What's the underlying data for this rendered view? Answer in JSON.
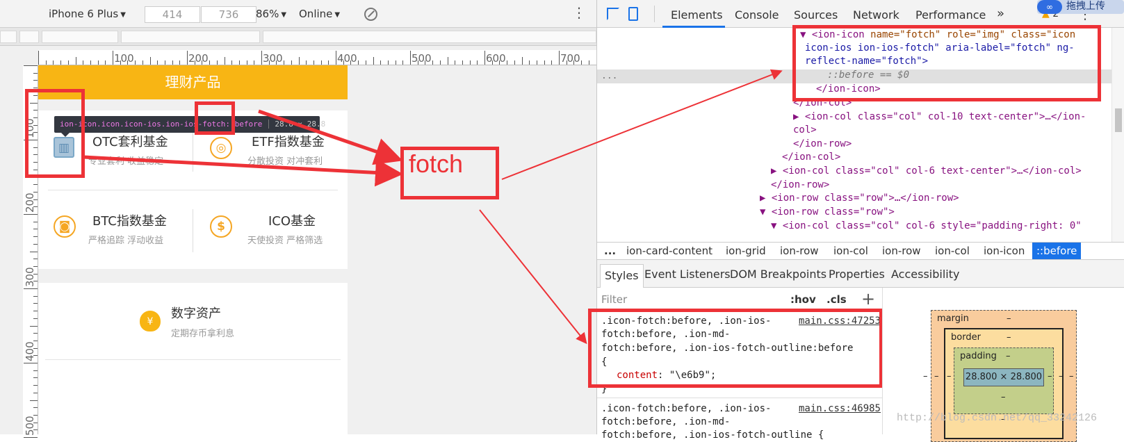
{
  "device_toolbar": {
    "device": "iPhone 6 Plus",
    "width": "414",
    "times": "×",
    "height": "736",
    "zoom": "86%",
    "network": "Online",
    "arrow": "▼",
    "rotate_icon": "rotate-icon",
    "more": "⋮"
  },
  "ruler": {
    "h_labels": [
      "100",
      "200",
      "300",
      "400",
      "500",
      "600",
      "700"
    ],
    "v_labels": [
      "100",
      "200",
      "300",
      "400",
      "500"
    ]
  },
  "phone": {
    "header_title": "理财产品",
    "products": [
      {
        "title": "OTC套利基金",
        "subtitle": "专业套利 收益稳定"
      },
      {
        "title": "ETF指数基金",
        "subtitle": "分散投资 对冲套利"
      },
      {
        "title": "BTC指数基金",
        "subtitle": "严格追踪 浮动收益"
      },
      {
        "title": "ICO基金",
        "subtitle": "天使投资 严格筛选"
      }
    ],
    "asset": {
      "title": "数字资产",
      "subtitle": "定期存币拿利息"
    }
  },
  "tooltip": {
    "selector": "ion-icon.icon.icon-ios.ion-ios-fotch::before",
    "size": "28.8 × 28.8"
  },
  "annotation": {
    "label": "fotch"
  },
  "devtools": {
    "tabs": [
      "Elements",
      "Console",
      "Sources",
      "Network",
      "Performance"
    ],
    "more_tabs": "»",
    "warning_count": "2",
    "top_right": "拖拽上传",
    "dom_lines": [
      {
        "tag": "▼ <ion-icon",
        "attrs": " name=\"fotch\" role=\"img\" class=\"icon"
      },
      {
        "text": "icon-ios ion-ios-fotch\" aria-label=\"fotch\" ng-"
      },
      {
        "text": "reflect-name=\"fotch\">"
      },
      {
        "text": "::before == $0"
      },
      {
        "text": "</ion-icon>"
      },
      {
        "text": "</ion-col>"
      },
      {
        "text": "▶ <ion-col class=\"col\" col-10 text-center\">…</ion-"
      },
      {
        "text": "col>"
      },
      {
        "text": "</ion-row>"
      },
      {
        "text": "</ion-col>"
      },
      {
        "text": "▶ <ion-col class=\"col\" col-6 text-center\">…</ion-col>"
      },
      {
        "text": "</ion-row>"
      },
      {
        "text": "▶ <ion-row class=\"row\">…</ion-row>"
      },
      {
        "text": "▼ <ion-row class=\"row\">"
      },
      {
        "text": "▼ <ion-col class=\"col\" col-6 style=\"padding-right: 0\""
      }
    ],
    "ellipsis": "...",
    "breadcrumbs": [
      "...",
      "ion-card-content",
      "ion-grid",
      "ion-row",
      "ion-col",
      "ion-row",
      "ion-col",
      "ion-icon",
      "::before"
    ],
    "subtabs": [
      "Styles",
      "Event Listeners",
      "DOM Breakpoints",
      "Properties",
      "Accessibility"
    ],
    "filter": {
      "placeholder": "Filter",
      "hov": ":hov",
      "cls": ".cls",
      "plus": "+"
    },
    "rule1": {
      "lines": [
        ".icon-fotch:before, .ion-ios-",
        "fotch:before, .ion-md-",
        "fotch:before, .ion-ios-fotch-outline:before",
        "{"
      ],
      "prop": "content",
      "value": ": \"\\e6b9\";",
      "close": "}",
      "source": "main.css:47253"
    },
    "rule2": {
      "lines": [
        ".icon-fotch:before, .ion-ios-",
        "fotch:before, .ion-md-",
        "fotch:before, .ion-ios-fotch-outline {"
      ],
      "source": "main.css:46985"
    },
    "boxmodel": {
      "margin": "margin",
      "border": "border",
      "padding": "padding",
      "content": "28.800 × 28.800",
      "dash": "–"
    }
  },
  "watermark": "http://blog.csdn.net/qq_33242126",
  "colors": {
    "header": "#f8b514",
    "annotation": "#ed3237",
    "accent": "#1a73e8"
  }
}
